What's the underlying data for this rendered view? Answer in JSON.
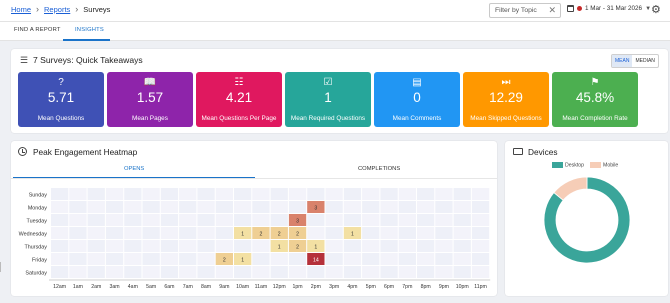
{
  "breadcrumb": {
    "home": "Home",
    "reports": "Reports",
    "current": "Surveys",
    "sep": "›"
  },
  "filter": {
    "placeholder": "Filter by Topic",
    "clear": "✕"
  },
  "date_range": "1 Mar - 31 Mar 2026",
  "nav_tabs": [
    "FIND A REPORT",
    "INSIGHTS"
  ],
  "takeaways": {
    "title": "7 Surveys: Quick Takeaways",
    "toggle": [
      "MEAN",
      "MEDIAN"
    ],
    "stats": [
      {
        "value": "5.71",
        "label": "Mean Questions",
        "color": "#3f51b5",
        "icon": "help-box-icon"
      },
      {
        "value": "1.57",
        "label": "Mean Pages",
        "color": "#8e24aa",
        "icon": "book-open-icon"
      },
      {
        "value": "4.21",
        "label": "Mean Questions Per Page",
        "color": "#e0185f",
        "icon": "list-box-icon"
      },
      {
        "value": "1",
        "label": "Mean Required Questions",
        "color": "#26a69a",
        "icon": "check-box-icon"
      },
      {
        "value": "0",
        "label": "Mean Comments",
        "color": "#2196f3",
        "icon": "comment-icon"
      },
      {
        "value": "12.29",
        "label": "Mean Skipped Questions",
        "color": "#ff9800",
        "icon": "skip-next-icon"
      },
      {
        "value": "45.8%",
        "label": "Mean Completion Rate",
        "color": "#4caf50",
        "icon": "flag-checkered-icon"
      }
    ]
  },
  "heatmap": {
    "title": "Peak Engagement Heatmap",
    "tabs": [
      "OPENS",
      "COMPLETIONS"
    ],
    "days": [
      "Sunday",
      "Monday",
      "Tuesday",
      "Wednesday",
      "Thursday",
      "Friday",
      "Saturday"
    ],
    "hours": [
      "12am",
      "1am",
      "2am",
      "3am",
      "4am",
      "5am",
      "6am",
      "7am",
      "8am",
      "9am",
      "10am",
      "11am",
      "12pm",
      "1pm",
      "2pm",
      "3pm",
      "4pm",
      "5pm",
      "6pm",
      "7pm",
      "8pm",
      "9pm",
      "10pm",
      "11pm"
    ],
    "cells": [
      {
        "day": 1,
        "hour": 14,
        "value": 3,
        "color": "#d9826b"
      },
      {
        "day": 2,
        "hour": 13,
        "value": 3,
        "color": "#d9826b"
      },
      {
        "day": 3,
        "hour": 10,
        "value": 1,
        "color": "#f3e0a3"
      },
      {
        "day": 3,
        "hour": 11,
        "value": 2,
        "color": "#efcf93"
      },
      {
        "day": 3,
        "hour": 12,
        "value": 2,
        "color": "#efcf93"
      },
      {
        "day": 3,
        "hour": 13,
        "value": 2,
        "color": "#efcf93"
      },
      {
        "day": 3,
        "hour": 16,
        "value": 1,
        "color": "#f3e0a3"
      },
      {
        "day": 4,
        "hour": 12,
        "value": 1,
        "color": "#f3e0a3"
      },
      {
        "day": 4,
        "hour": 13,
        "value": 2,
        "color": "#efcf93"
      },
      {
        "day": 4,
        "hour": 14,
        "value": 1,
        "color": "#f3e0a3"
      },
      {
        "day": 5,
        "hour": 9,
        "value": 2,
        "color": "#efcf93"
      },
      {
        "day": 5,
        "hour": 10,
        "value": 1,
        "color": "#f3e0a3"
      },
      {
        "day": 5,
        "hour": 14,
        "value": 14,
        "color": "#b5313a"
      }
    ]
  },
  "devices": {
    "title": "Devices",
    "legend": [
      "Desktop",
      "Mobile"
    ],
    "colors": {
      "Desktop": "#3aa59a",
      "Mobile": "#f6cdb7"
    }
  },
  "chart_data": {
    "type": "pie",
    "title": "Devices",
    "categories": [
      "Desktop",
      "Mobile"
    ],
    "values": [
      86,
      14
    ]
  }
}
